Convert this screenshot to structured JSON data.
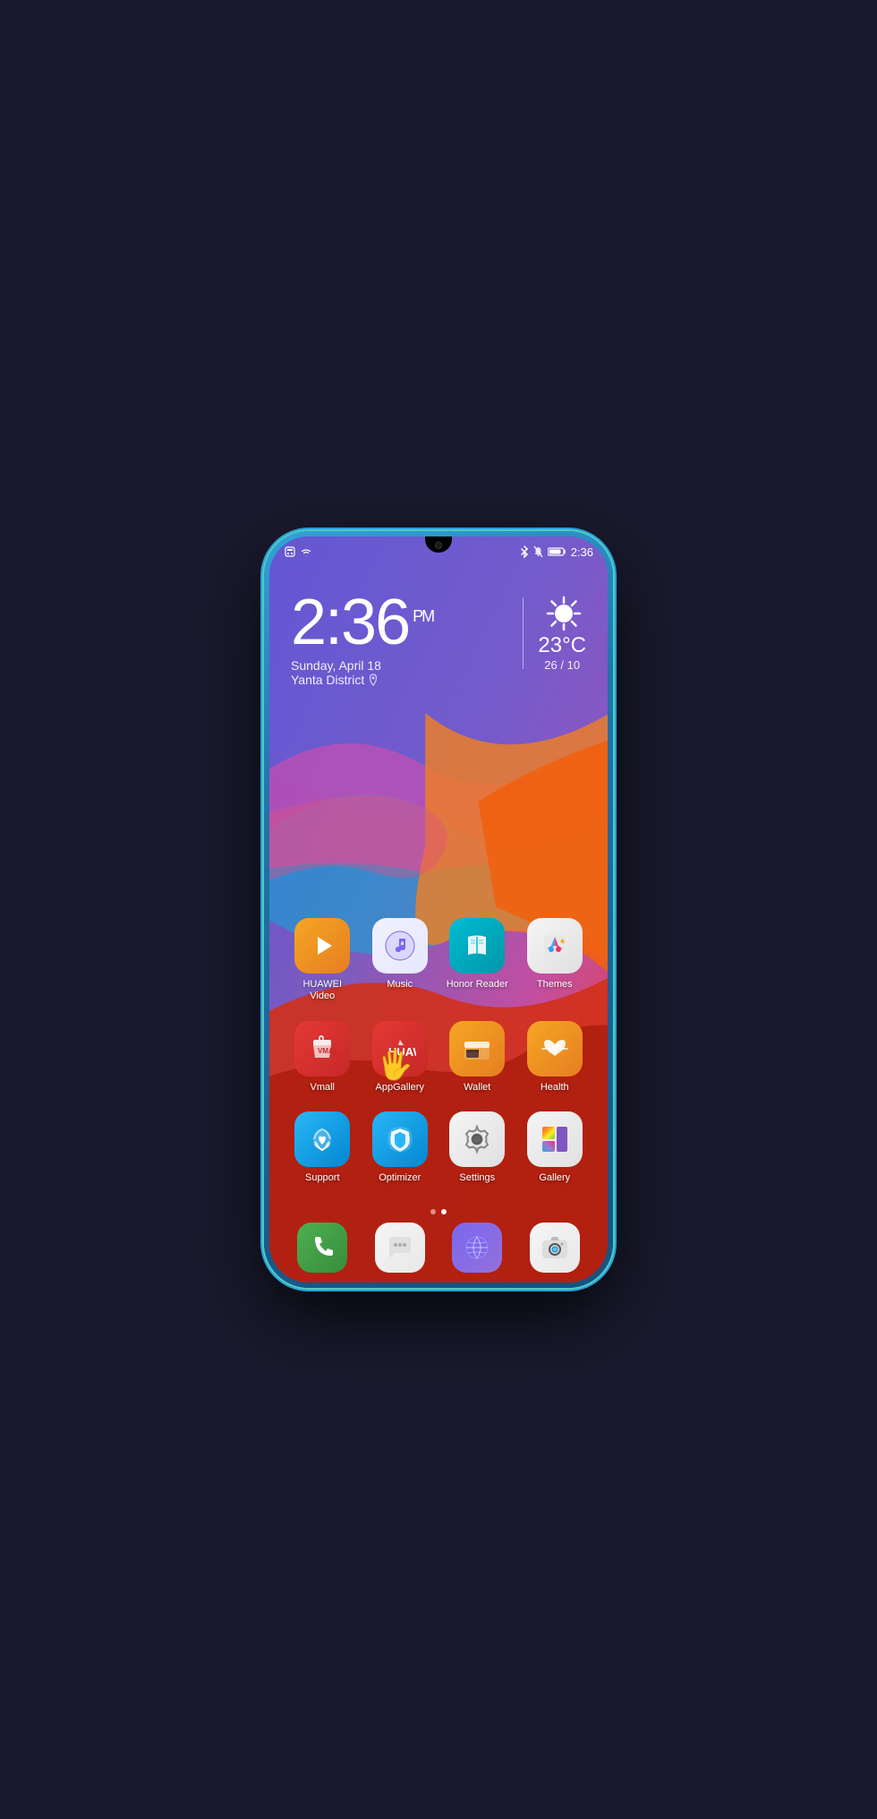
{
  "phone": {
    "status_bar": {
      "left_icons": [
        "sim-icon",
        "wifi-icon"
      ],
      "right_icons": [
        "bluetooth-icon",
        "bell-mute-icon",
        "battery-icon"
      ],
      "time": "2:36"
    },
    "clock": {
      "time": "2:36",
      "period": "PM",
      "date": "Sunday, April 18",
      "location": "Yanta District"
    },
    "weather": {
      "condition": "sunny",
      "temperature": "23°C",
      "range": "26 / 10"
    },
    "apps": {
      "row1": [
        {
          "name": "HUAWEI Video",
          "id": "huawei-video"
        },
        {
          "name": "Music",
          "id": "music"
        },
        {
          "name": "Honor Reader",
          "id": "honor-reader"
        },
        {
          "name": "Themes",
          "id": "themes"
        }
      ],
      "row2": [
        {
          "name": "Vmall",
          "id": "vmall"
        },
        {
          "name": "AppGallery",
          "id": "appgallery"
        },
        {
          "name": "Wallet",
          "id": "wallet"
        },
        {
          "name": "Health",
          "id": "health"
        }
      ],
      "row3": [
        {
          "name": "Support",
          "id": "support"
        },
        {
          "name": "Optimizer",
          "id": "optimizer"
        },
        {
          "name": "Settings",
          "id": "settings"
        },
        {
          "name": "Gallery",
          "id": "gallery"
        }
      ]
    },
    "dock": [
      {
        "name": "Phone",
        "id": "phone"
      },
      {
        "name": "Messages",
        "id": "messages"
      },
      {
        "name": "Browser",
        "id": "browser"
      },
      {
        "name": "Camera",
        "id": "camera"
      }
    ],
    "page_dots": [
      {
        "active": false
      },
      {
        "active": true
      }
    ]
  }
}
